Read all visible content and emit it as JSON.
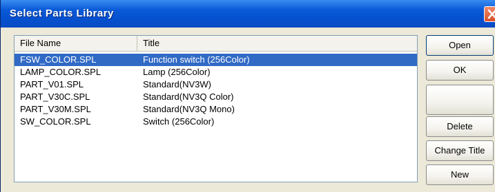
{
  "window": {
    "title": "Select Parts Library"
  },
  "list": {
    "columns": [
      "File Name",
      "Title"
    ],
    "rows": [
      {
        "file": "FSW_COLOR.SPL",
        "title": "Function switch (256Color)",
        "selected": true
      },
      {
        "file": "LAMP_COLOR.SPL",
        "title": "Lamp (256Color)"
      },
      {
        "file": "PART_V01.SPL",
        "title": "Standard(NV3W)"
      },
      {
        "file": "PART_V30C.SPL",
        "title": "Standard(NV3Q Color)"
      },
      {
        "file": "PART_V30M.SPL",
        "title": "Standard(NV3Q Mono)"
      },
      {
        "file": "SW_COLOR.SPL",
        "title": "Switch (256Color)"
      }
    ]
  },
  "buttons": {
    "open": "Open",
    "ok": "OK",
    "delete": "Delete",
    "change_title": "Change Title",
    "new": "New"
  },
  "icons": {
    "close": "close-icon"
  },
  "colors": {
    "selection": "#316ac5",
    "titlebar": "#0a5ad8"
  }
}
